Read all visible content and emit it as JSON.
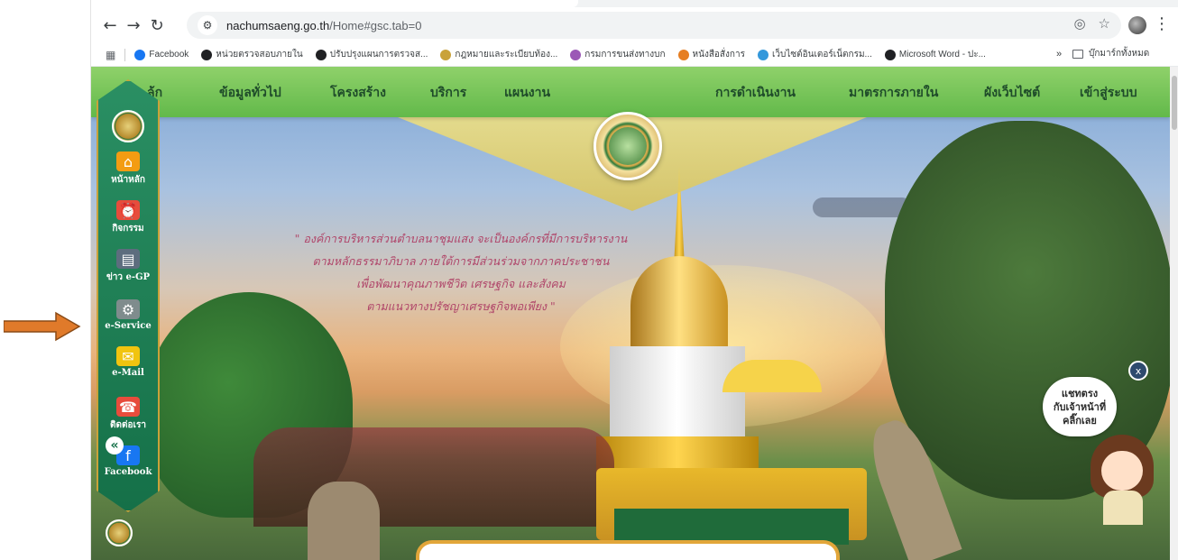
{
  "browser": {
    "url_host": "nachumsaeng.go.th",
    "url_path": "/Home#gsc.tab=0",
    "bookmarks": [
      {
        "label": "Facebook",
        "color": "#1877f2"
      },
      {
        "label": "หน่วยตรวจสอบภายใน",
        "color": "#202124"
      },
      {
        "label": "ปรับปรุงแผนการตรวจส...",
        "color": "#202124"
      },
      {
        "label": "กฎหมายและระเบียบท้อง...",
        "color": "#c9a23a"
      },
      {
        "label": "กรมการขนส่งทางบก",
        "color": "#9b59b6"
      },
      {
        "label": "หนังสือสั่งการ",
        "color": "#e67e22"
      },
      {
        "label": "เว็บไซต์อินเตอร์เน็ตกรม...",
        "color": "#3498db"
      },
      {
        "label": "Microsoft Word - ปะ...",
        "color": "#202124"
      }
    ],
    "bookmarks_more": "»",
    "bookmarks_folder": "บุ๊กมาร์กทั้งหมด"
  },
  "site_nav": {
    "items": [
      "ล้ก",
      "ข้อมูลทั่วไป",
      "โครงสร้าง",
      "บริการ",
      "แผนงาน",
      "การดำเนินงาน",
      "มาตรการภายใน",
      "ผังเว็บไซต์",
      "เข้าสู่ระบบ"
    ]
  },
  "vision": {
    "lines": [
      "\" องค์การบริหารส่วนตำบลนาชุมแสง จะเป็นองค์กรที่มีการบริหารงาน",
      "ตามหลักธรรมาภิบาล ภายใต้การมีส่วนร่วมจากภาคประชาชน",
      "เพื่อพัฒนาคุณภาพชีวิต เศรษฐกิจ และสังคม",
      "ตามแนวทางปรัชญาเศรษฐกิจพอเพียง \""
    ]
  },
  "side_menu": {
    "items": [
      {
        "label": "หน้าหลัก",
        "icon": "house-icon",
        "color": "#f39c12"
      },
      {
        "label": "กิจกรรม",
        "icon": "alarm-clock-icon",
        "color": "#e74c3c"
      },
      {
        "label": "ข่าว e-GP",
        "icon": "news-icon",
        "color": "#5d6d7e"
      },
      {
        "label": "e-Service",
        "icon": "service-icon",
        "color": "#7f8c8d"
      },
      {
        "label": "e-Mail",
        "icon": "mail-icon",
        "color": "#f1c40f"
      },
      {
        "label": "ติดต่อเรา",
        "icon": "contact-icon",
        "color": "#e74c3c"
      },
      {
        "label": "Facebook",
        "icon": "facebook-icon",
        "color": "#1877f2"
      }
    ],
    "collapse_label": "«"
  },
  "chat": {
    "lines": [
      "แชทตรง",
      "กับเจ้าหน้าที่",
      "คลิ๊กเลย"
    ],
    "close_label": "x"
  },
  "colors": {
    "nav_green": "#62b94a",
    "sidebar_green": "#157048",
    "gold": "#c9a23a",
    "vision_text": "#b0466a",
    "arrow": "#e07a2a"
  }
}
